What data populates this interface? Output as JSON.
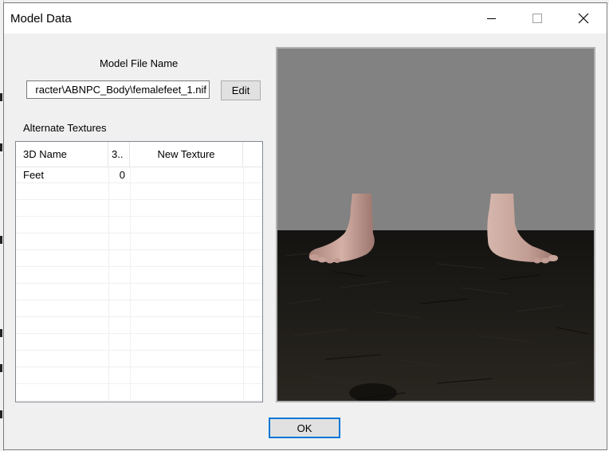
{
  "window": {
    "title": "Model Data"
  },
  "model_file": {
    "label": "Model File Name",
    "value": "racter\\ABNPC_Body\\femalefeet_1.nif",
    "edit_label": "Edit"
  },
  "alternate_textures": {
    "label": "Alternate Textures",
    "columns": [
      "3D Name",
      "3..",
      "New Texture"
    ],
    "rows": [
      {
        "name": "Feet",
        "index": "0",
        "texture": ""
      }
    ]
  },
  "buttons": {
    "ok_label": "OK"
  },
  "preview": {
    "subject": "female feet model",
    "sky_color": "#828282",
    "ground_color": "#1b1a17",
    "skin_color": "#c9a49a"
  }
}
